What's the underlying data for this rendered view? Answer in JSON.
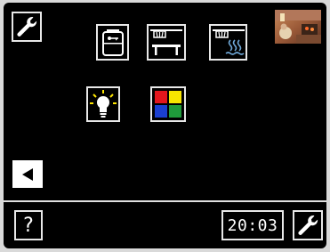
{
  "header": {
    "settings_icon": "wrench-icon",
    "camera_icon": "camera-thumbnail-icon"
  },
  "programs": [
    {
      "name": "sauna-heater",
      "icon": "sauna-stove-icon"
    },
    {
      "name": "sauna-bench",
      "icon": "bench-lamp-icon"
    },
    {
      "name": "steam-bath",
      "icon": "steam-icon"
    },
    {
      "name": "lighting",
      "icon": "light-bulb-icon"
    },
    {
      "name": "color-light",
      "icon": "color-light-icon"
    }
  ],
  "colors": {
    "red": "#e3161d",
    "yellow": "#f7e500",
    "blue": "#1b3fd0",
    "green": "#1f9a3b",
    "bulb": "#ffe600",
    "steam": "#6fa8d8"
  },
  "footer": {
    "help_label": "?",
    "time": "20:03",
    "settings_icon": "wrench-icon"
  }
}
